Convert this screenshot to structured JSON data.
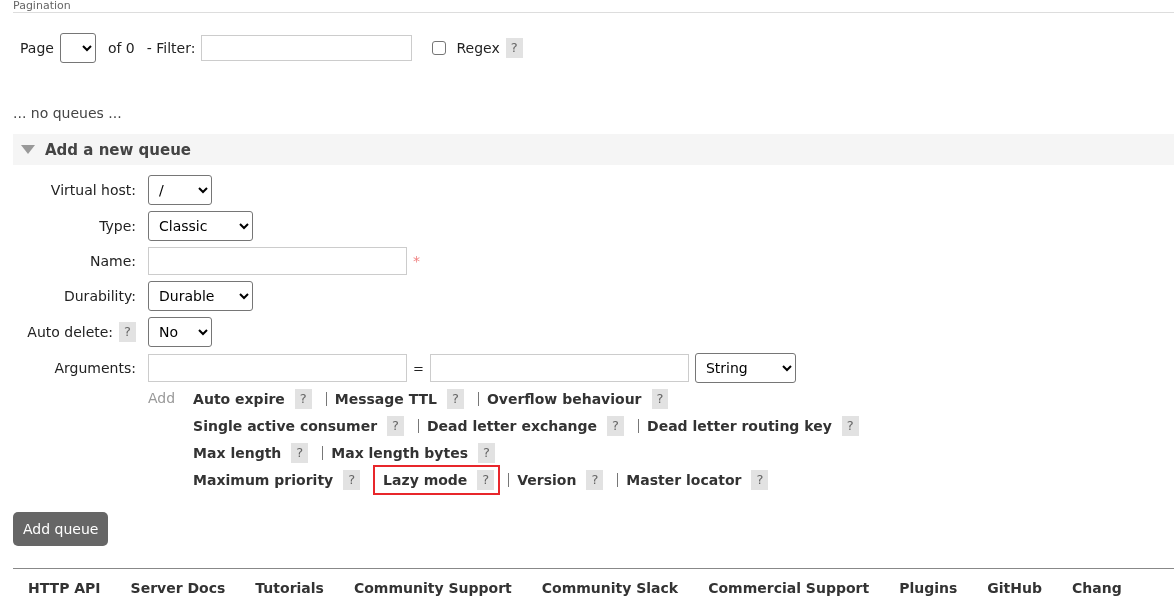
{
  "section_legend": "Pagination",
  "pagination": {
    "page_label": "Page",
    "of_label": "of 0",
    "filter_label": "- Filter:",
    "regex": {
      "label": "Regex",
      "checked": false,
      "help": "?"
    }
  },
  "empty_message": "... no queues ...",
  "add_queue": {
    "title": "Add a new queue",
    "expanded": true,
    "fields": [
      {
        "kind": "select",
        "label": "Virtual host:",
        "value": "/"
      },
      {
        "kind": "select",
        "label": "Type:",
        "value": "Classic"
      },
      {
        "kind": "text",
        "label": "Name:",
        "required_mark": "*"
      },
      {
        "kind": "select",
        "label": "Durability:",
        "value": "Durable"
      },
      {
        "kind": "select",
        "label": "Auto delete:",
        "help": "?",
        "value": "No"
      },
      {
        "kind": "arguments",
        "label": "Arguments:",
        "equals": "=",
        "type_value": "String"
      }
    ],
    "add_label": "Add",
    "argument_lines": [
      [
        {
          "label": "Auto expire",
          "help": "?",
          "highlighted": false
        },
        {
          "label": "Message TTL",
          "help": "?",
          "highlighted": false
        },
        {
          "label": "Overflow behaviour",
          "help": "?",
          "highlighted": false
        }
      ],
      [
        {
          "label": "Single active consumer",
          "help": "?",
          "highlighted": false
        },
        {
          "label": "Dead letter exchange",
          "help": "?",
          "highlighted": false
        },
        {
          "label": "Dead letter routing key",
          "help": "?",
          "highlighted": false
        }
      ],
      [
        {
          "label": "Max length",
          "help": "?",
          "highlighted": false
        },
        {
          "label": "Max length bytes",
          "help": "?",
          "highlighted": false
        }
      ],
      [
        {
          "label": "Maximum priority",
          "help": "?",
          "highlighted": false
        },
        {
          "label": "Lazy mode",
          "help": "?",
          "highlighted": true
        },
        {
          "label": "Version",
          "help": "?",
          "highlighted": false
        },
        {
          "label": "Master locator",
          "help": "?",
          "highlighted": false
        }
      ]
    ],
    "submit": "Add queue"
  },
  "footer_links": [
    "HTTP API",
    "Server Docs",
    "Tutorials",
    "Community Support",
    "Community Slack",
    "Commercial Support",
    "Plugins",
    "GitHub",
    "Chang"
  ]
}
